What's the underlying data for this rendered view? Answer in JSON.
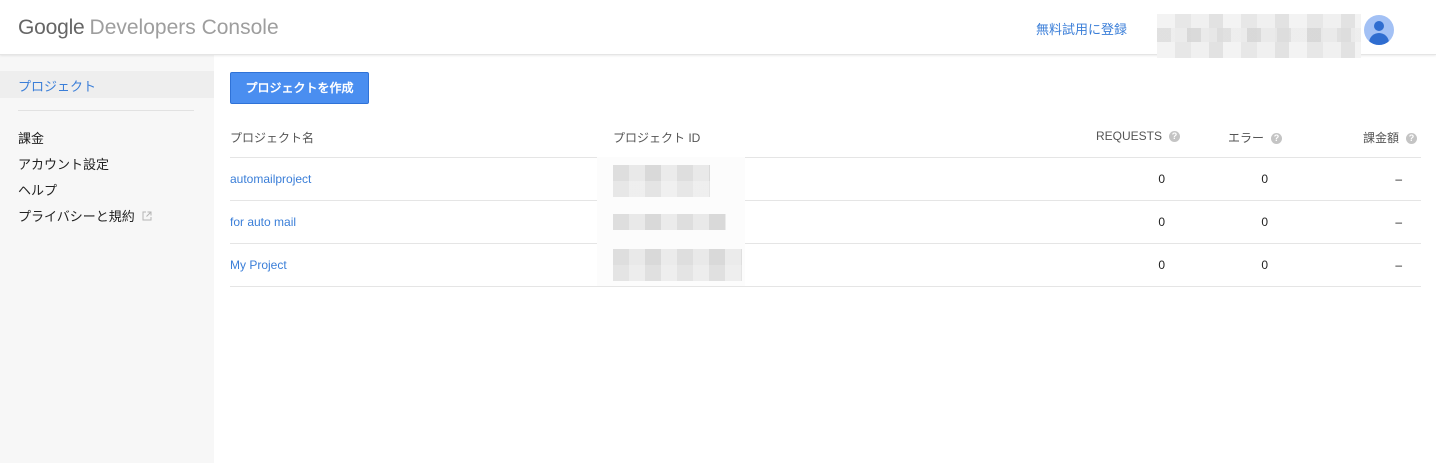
{
  "header": {
    "brand_google": "Google",
    "brand_rest": "Developers Console",
    "trial_link": "無料試用に登録"
  },
  "sidebar": {
    "active_item": "プロジェクト",
    "items": [
      {
        "label": "課金"
      },
      {
        "label": "アカウント設定"
      },
      {
        "label": "ヘルプ"
      },
      {
        "label": "プライバシーと規約",
        "icon": "external-link-icon"
      }
    ]
  },
  "main": {
    "create_button": "プロジェクトを作成",
    "columns": {
      "name": "プロジェクト名",
      "id": "プロジェクト ID",
      "requests": "REQUESTS",
      "errors": "エラー",
      "billing": "課金額",
      "help_glyph": "?"
    },
    "rows": [
      {
        "name": "automailproject",
        "requests": "0",
        "errors": "0",
        "billing": "–"
      },
      {
        "name": "for auto mail",
        "requests": "0",
        "errors": "0",
        "billing": "–"
      },
      {
        "name": "My Project",
        "requests": "0",
        "errors": "0",
        "billing": "–"
      }
    ]
  },
  "colors": {
    "accent": "#3a7ed8",
    "button": "#4a8ef0",
    "sidebar_bg": "#f7f7f7"
  }
}
